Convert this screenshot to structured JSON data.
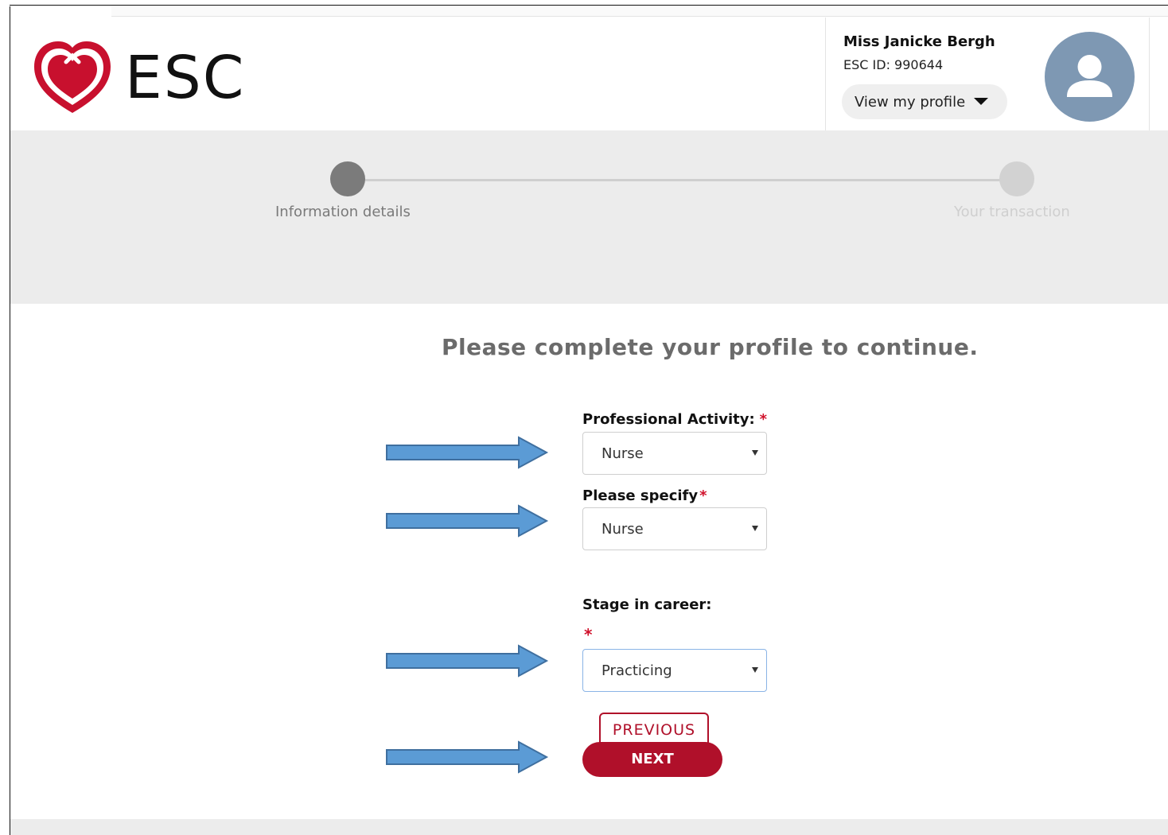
{
  "header": {
    "logo_text": "ESC",
    "user": {
      "name": "Miss Janicke Bergh",
      "esc_id": "ESC ID: 990644",
      "profile_button": "View my profile"
    }
  },
  "stepper": {
    "steps": [
      {
        "label": "Information details",
        "state": "active"
      },
      {
        "label": "Your transaction",
        "state": "inactive"
      }
    ]
  },
  "form": {
    "title": "Please complete your profile to continue.",
    "required_marker": "*",
    "professional_activity": {
      "label": "Professional Activity:",
      "value": "Nurse"
    },
    "specify": {
      "label": "Please specify",
      "value": "Nurse"
    },
    "career_stage": {
      "label": "Stage in career:",
      "value": "Practicing"
    },
    "previous_label": "PREVIOUS",
    "next_label": "NEXT"
  },
  "colors": {
    "brand_red": "#b0102a",
    "required_red": "#d0112b",
    "avatar_blue": "#7e98b3",
    "annotation_arrow": "#5b9bd5"
  },
  "icons": [
    "heart-logo-icon",
    "chevron-down-icon",
    "user-avatar-icon",
    "annotation-arrow-icon"
  ]
}
